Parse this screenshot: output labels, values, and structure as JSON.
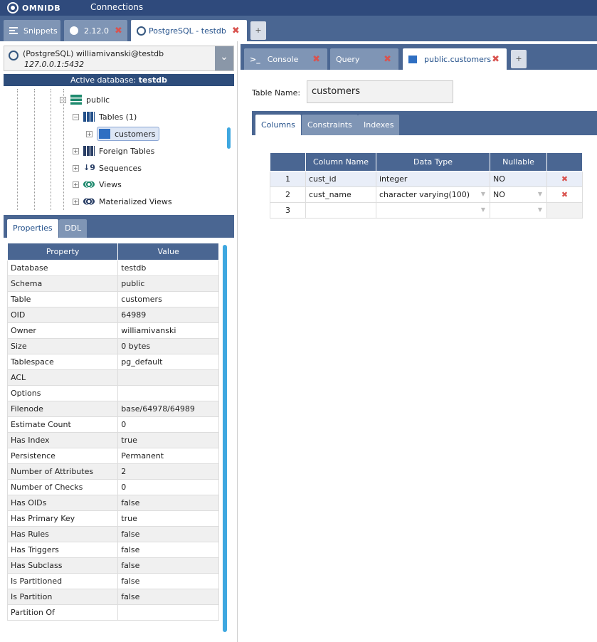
{
  "topbar": {
    "brand": "OMNIDB",
    "menu": "Connections"
  },
  "outer_tabs": [
    {
      "label": "Snippets",
      "icon": "list-icon"
    },
    {
      "label": "2.12.0",
      "icon": "globe-icon"
    },
    {
      "label": "PostgreSQL - testdb",
      "icon": "postgres-icon"
    }
  ],
  "outer_add": "+",
  "db": {
    "title": "(PostgreSQL) williamivanski@testdb",
    "host": "127.0.0.1:5432",
    "active_prefix": "Active database:",
    "active_name": "testdb"
  },
  "tree": [
    {
      "label": "public",
      "icon": "layers-icon"
    },
    {
      "label": "Tables (1)",
      "icon": "table-grid-icon"
    },
    {
      "label": "customers",
      "icon": "table-icon"
    },
    {
      "label": "Foreign Tables",
      "icon": "table-grid-icon"
    },
    {
      "label": "Sequences",
      "icon": "sort-icon"
    },
    {
      "label": "Views",
      "icon": "eye-icon"
    },
    {
      "label": "Materialized Views",
      "icon": "eye-icon"
    }
  ],
  "prop_tabs": [
    "Properties",
    "DDL"
  ],
  "prop_headers": [
    "Property",
    "Value"
  ],
  "properties": [
    [
      "Database",
      "testdb"
    ],
    [
      "Schema",
      "public"
    ],
    [
      "Table",
      "customers"
    ],
    [
      "OID",
      "64989"
    ],
    [
      "Owner",
      "williamivanski"
    ],
    [
      "Size",
      "0 bytes"
    ],
    [
      "Tablespace",
      "pg_default"
    ],
    [
      "ACL",
      ""
    ],
    [
      "Options",
      ""
    ],
    [
      "Filenode",
      "base/64978/64989"
    ],
    [
      "Estimate Count",
      "0"
    ],
    [
      "Has Index",
      "true"
    ],
    [
      "Persistence",
      "Permanent"
    ],
    [
      "Number of Attributes",
      "2"
    ],
    [
      "Number of Checks",
      "0"
    ],
    [
      "Has OIDs",
      "false"
    ],
    [
      "Has Primary Key",
      "true"
    ],
    [
      "Has Rules",
      "false"
    ],
    [
      "Has Triggers",
      "false"
    ],
    [
      "Has Subclass",
      "false"
    ],
    [
      "Is Partitioned",
      "false"
    ],
    [
      "Is Partition",
      "false"
    ],
    [
      "Partition Of",
      ""
    ]
  ],
  "inner_tabs": [
    {
      "label": "Console",
      "icon": "terminal-icon"
    },
    {
      "label": "Query",
      "icon": ""
    },
    {
      "label": "public.customers",
      "icon": "table-icon"
    }
  ],
  "inner_add": "+",
  "editor": {
    "table_name_label": "Table Name:",
    "table_name_value": "customers",
    "subtabs": [
      "Columns",
      "Constraints",
      "Indexes"
    ],
    "col_headers": [
      "",
      "Column Name",
      "Data Type",
      "Nullable",
      ""
    ],
    "rows": [
      {
        "num": "1",
        "name": "cust_id",
        "type": "integer",
        "nullable": "NO"
      },
      {
        "num": "2",
        "name": "cust_name",
        "type": "character varying(100)",
        "nullable": "NO"
      },
      {
        "num": "3",
        "name": "",
        "type": "",
        "nullable": ""
      }
    ]
  },
  "colors": {
    "header": "#4a6692",
    "topbar": "#2f4a7c",
    "close": "#d9534f",
    "scroll": "#3ea7e0"
  }
}
